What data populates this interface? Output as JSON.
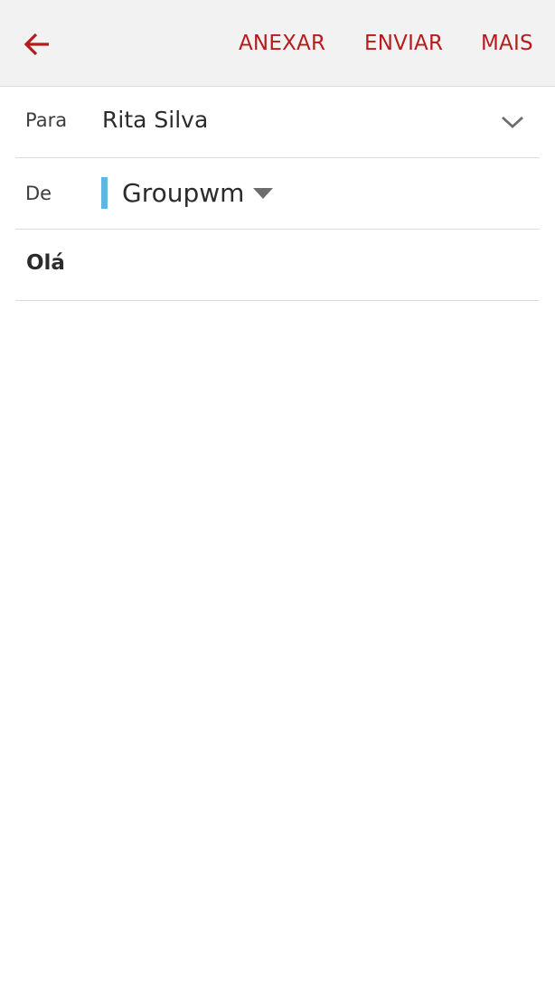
{
  "colors": {
    "accent": "#b71c1c",
    "toolbar_bg": "#f2f2f2",
    "account_indicator": "#5bb8e0",
    "text_primary": "#2b2b2b",
    "divider": "#dcdcdc"
  },
  "toolbar": {
    "back_icon": "arrow-left-icon",
    "actions": [
      {
        "label": "ANEXAR"
      },
      {
        "label": "ENVIAR"
      },
      {
        "label": "MAIS"
      }
    ]
  },
  "compose": {
    "to": {
      "label": "Para",
      "value": "Rita Silva",
      "expand_icon": "chevron-down-icon"
    },
    "from": {
      "label": "De",
      "value": "Groupwm",
      "dropdown_icon": "triangle-down-icon"
    },
    "subject": "Olá",
    "body": ""
  }
}
